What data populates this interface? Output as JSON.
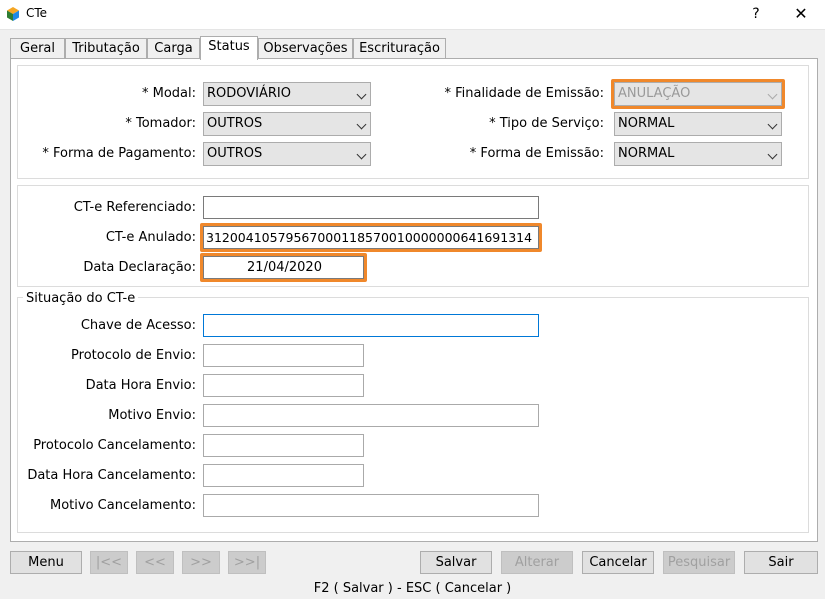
{
  "window": {
    "title": "CTe",
    "help_label": "?",
    "close_label": "✕"
  },
  "tabs": [
    {
      "label": "Geral"
    },
    {
      "label": "Tributação"
    },
    {
      "label": "Carga"
    },
    {
      "label": "Status"
    },
    {
      "label": "Observações"
    },
    {
      "label": "Escrituração"
    }
  ],
  "active_tab": "Status",
  "emission": {
    "modal_label": "* Modal:",
    "modal_value": "RODOVIÁRIO",
    "tomador_label": "* Tomador:",
    "tomador_value": "OUTROS",
    "pagamento_label": "* Forma de Pagamento:",
    "pagamento_value": "OUTROS",
    "finalidade_label": "* Finalidade de Emissão:",
    "finalidade_value": "ANULAÇÃO",
    "servico_label": "* Tipo de Serviço:",
    "servico_value": "NORMAL",
    "forma_emissao_label": "* Forma de Emissão:",
    "forma_emissao_value": "NORMAL"
  },
  "reference": {
    "referenciado_label": "CT-e Referenciado:",
    "referenciado_value": "",
    "anulado_label": "CT-e Anulado:",
    "anulado_value": "31200410579567000118570010000000641691314",
    "data_label": "Data Declaração:",
    "data_value": "21/04/2020"
  },
  "situacao": {
    "legend": "Situação do CT-e",
    "chave_label": "Chave de Acesso:",
    "chave_value": "",
    "protocolo_envio_label": "Protocolo de Envio:",
    "protocolo_envio_value": "",
    "data_hora_envio_label": "Data Hora Envio:",
    "data_hora_envio_value": "",
    "motivo_envio_label": "Motivo Envio:",
    "motivo_envio_value": "",
    "protocolo_cancel_label": "Protocolo Cancelamento:",
    "protocolo_cancel_value": "",
    "data_hora_cancel_label": "Data Hora Cancelamento:",
    "data_hora_cancel_value": "",
    "motivo_cancel_label": "Motivo Cancelamento:",
    "motivo_cancel_value": ""
  },
  "buttons": {
    "menu": "Menu",
    "first": "|<<",
    "prev": "<<",
    "next": ">>",
    "last": ">>|",
    "salvar": "Salvar",
    "alterar": "Alterar",
    "cancelar": "Cancelar",
    "pesquisar": "Pesquisar",
    "sair": "Sair"
  },
  "statusbar": "F2 ( Salvar )  -  ESC ( Cancelar )",
  "colors": {
    "highlight": "#f0882b",
    "focus": "#0078d7"
  }
}
